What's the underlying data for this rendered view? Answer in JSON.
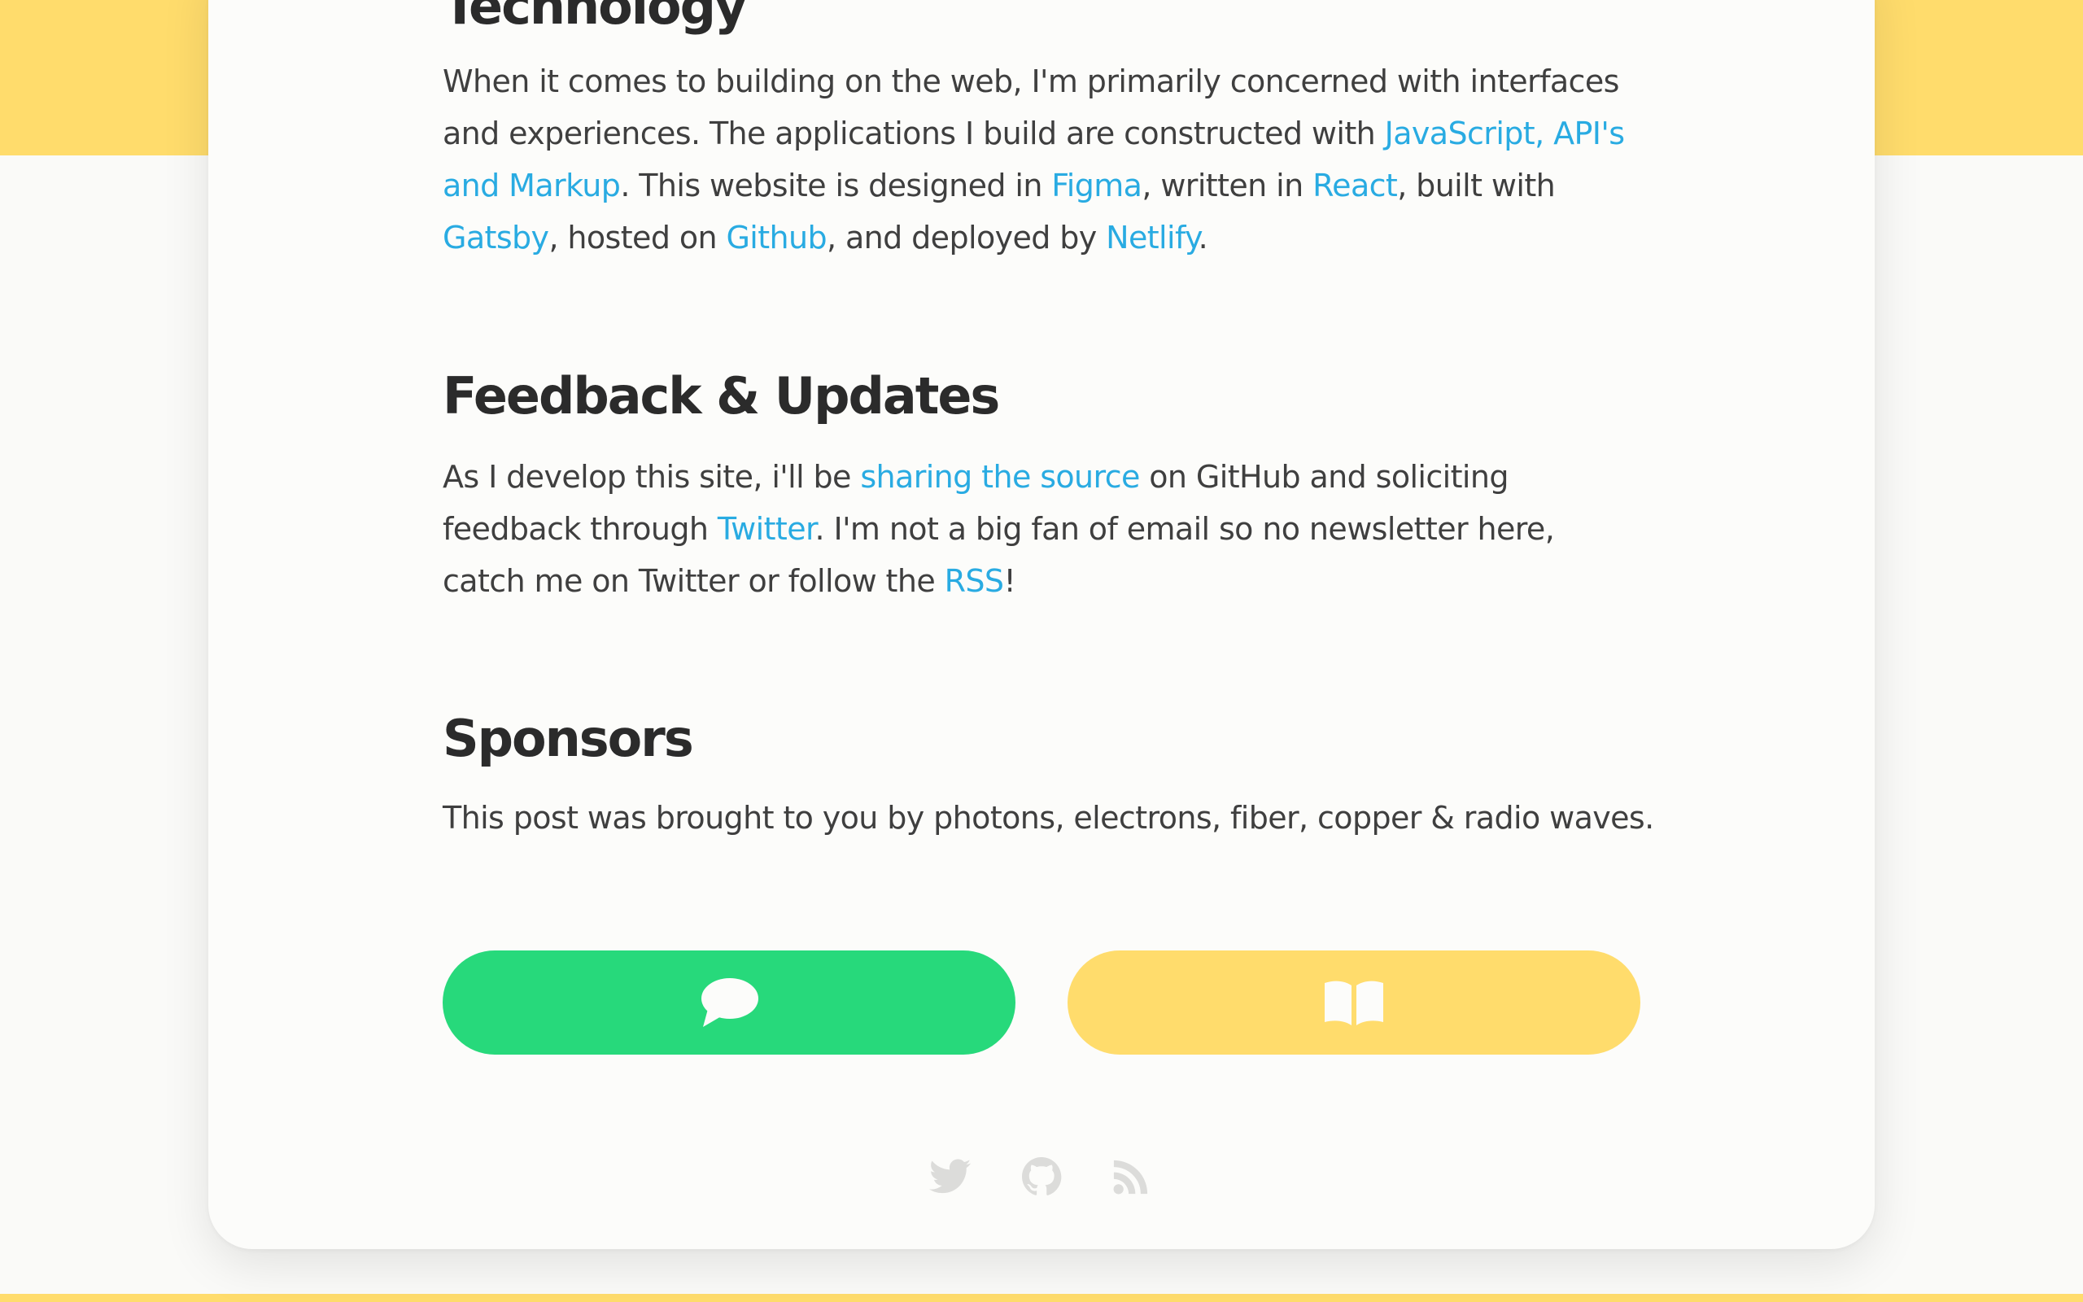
{
  "sections": {
    "technology": {
      "title": "Technology",
      "p1": "When it comes to building on the web, I'm primarily concerned with interfaces and experiences. The applications I build are constructed with ",
      "link_jam": "JavaScript, API's and Markup",
      "p2": ". This website is designed in ",
      "link_figma": "Figma",
      "p3": ", written in ",
      "link_react": "React",
      "p4": ", built with ",
      "link_gatsby": "Gatsby",
      "p5": ", hosted on ",
      "link_github": "Github",
      "p6": ", and deployed by ",
      "link_netlify": "Netlify",
      "p7": "."
    },
    "feedback": {
      "title": "Feedback & Updates",
      "p1": "As I develop this site, i'll be ",
      "link_source": "sharing the source",
      "p2": " on GitHub and soliciting feedback through ",
      "link_twitter": "Twitter",
      "p3": ". I'm not a big fan of email so no newsletter here, catch me on Twitter or follow the ",
      "link_rss": "RSS",
      "p4": "!"
    },
    "sponsors": {
      "title": "Sponsors",
      "text": "This post was brought to you by photons, electrons, fiber, copper & radio waves."
    }
  },
  "actions": {
    "discuss_icon": "chat-bubble-icon",
    "read_icon": "open-book-icon"
  },
  "footer": {
    "icons": [
      "twitter-icon",
      "github-icon",
      "rss-icon"
    ]
  },
  "colors": {
    "accent_yellow": "#ffdc6c",
    "discuss_green": "#27d97b",
    "link_blue": "#29abe2",
    "heading": "#2b2b2b",
    "body_text": "#3f3f3f",
    "footer_icon": "#dcdcda",
    "card_bg": "#fcfcfa"
  }
}
